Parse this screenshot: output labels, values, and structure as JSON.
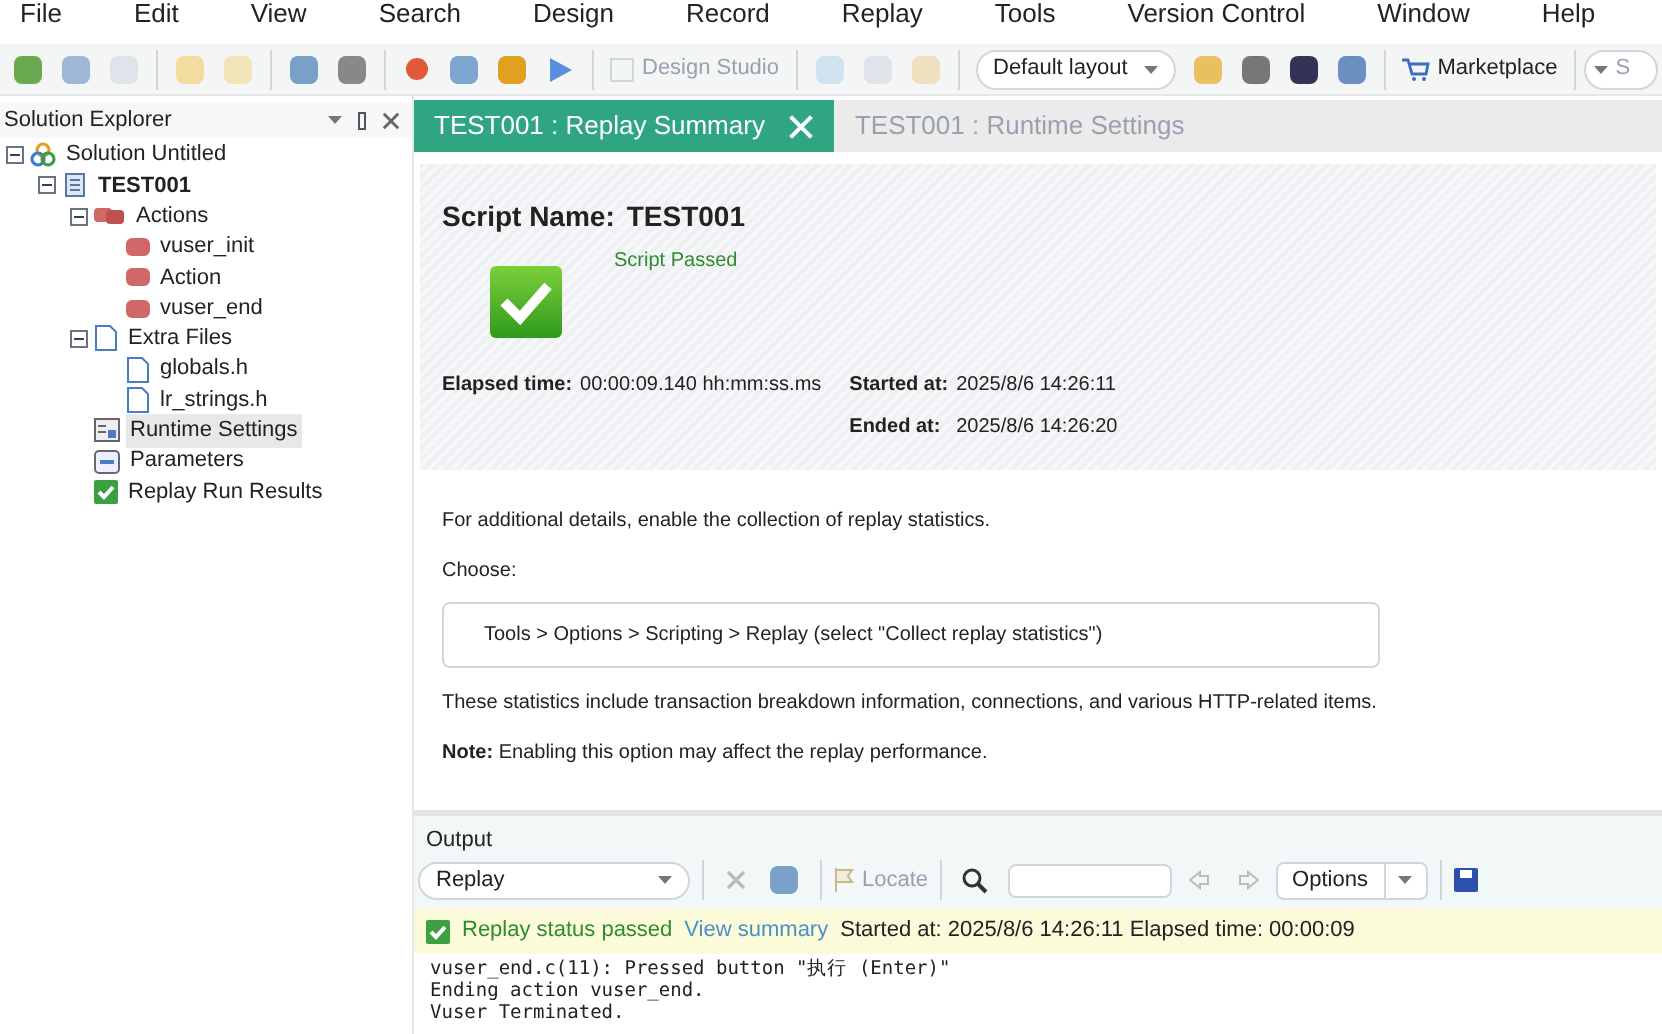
{
  "menu": [
    "File",
    "Edit",
    "View",
    "Search",
    "Design",
    "Record",
    "Replay",
    "Tools",
    "Version Control",
    "Window",
    "Help"
  ],
  "toolbar": {
    "design_studio": "Design Studio",
    "layout": "Default layout",
    "marketplace": "Marketplace",
    "search_placeholder": "S"
  },
  "sidebar": {
    "title": "Solution Explorer",
    "tree": [
      {
        "label": "Solution Untitled",
        "kind": "solution",
        "expanded": true,
        "children": [
          {
            "label": "TEST001",
            "kind": "script",
            "expanded": true,
            "children": [
              {
                "label": "Actions",
                "kind": "actions",
                "expanded": true,
                "children": [
                  {
                    "label": "vuser_init",
                    "kind": "action"
                  },
                  {
                    "label": "Action",
                    "kind": "action"
                  },
                  {
                    "label": "vuser_end",
                    "kind": "action"
                  }
                ]
              },
              {
                "label": "Extra Files",
                "kind": "folder",
                "expanded": true,
                "children": [
                  {
                    "label": "globals.h",
                    "kind": "file"
                  },
                  {
                    "label": "lr_strings.h",
                    "kind": "file"
                  }
                ]
              },
              {
                "label": "Runtime Settings",
                "kind": "settings",
                "selected": true
              },
              {
                "label": "Parameters",
                "kind": "params",
                "selected": false
              },
              {
                "label": "Replay Run Results",
                "kind": "results",
                "selected": false
              }
            ]
          }
        ]
      }
    ]
  },
  "tabs": [
    {
      "label": "TEST001 : Replay Summary",
      "selected": true
    },
    {
      "label": "TEST001 : Runtime Settings",
      "selected": false
    }
  ],
  "summary": {
    "script_name_label": "Script Name:",
    "script_name": "TEST001",
    "status": "Script Passed",
    "passed": true,
    "elapsed_label": "Elapsed time:",
    "elapsed": "00:00:09.140 hh:mm:ss.ms",
    "started_label": "Started at:",
    "started": "2025/8/6 14:26:11",
    "ended_label": "Ended at:",
    "ended": "2025/8/6 14:26:20"
  },
  "details": {
    "intro": "For additional details, enable the collection of replay statistics.",
    "choose": "Choose:",
    "path": "Tools > Options > Scripting > Replay (select \"Collect replay statistics\")",
    "stats": "These statistics include transaction breakdown information, connections, and various HTTP-related items.",
    "note": "**Note:** Enabling this option may affect the replay performance."
  },
  "output": {
    "title": "Output",
    "source": "Replay",
    "locate": "Locate",
    "options": "Options",
    "status": "Replay status passed",
    "view_summary": "View summary",
    "status_info": "Started at: 2025/8/6 14:26:11 Elapsed time: 00:00:09",
    "log": [
      "vuser_end.c(11): Pressed button \"执行   (Enter)\"",
      "Ending action vuser_end.",
      "Vuser Terminated."
    ]
  }
}
